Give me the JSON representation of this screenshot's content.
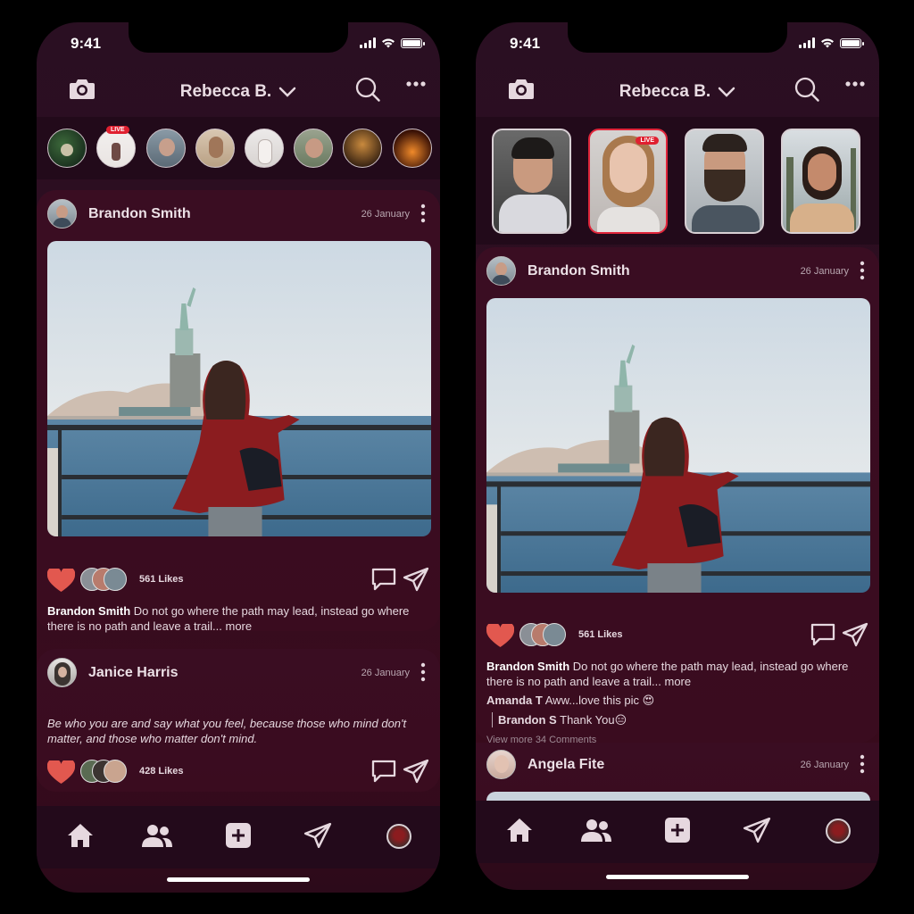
{
  "colors": {
    "accent": "#e2584f",
    "live": "#e0253a",
    "background": "#2e0d20"
  },
  "status": {
    "time": "9:41"
  },
  "header": {
    "account_name": "Rebecca B."
  },
  "stories": {
    "live_label": "LIVE"
  },
  "posts": [
    {
      "author": "Brandon Smith",
      "date": "26 January",
      "likes": "561 Likes",
      "caption_author": "Brandon Smith",
      "caption_text": "Do not go where the path may lead, instead go where there is no path and leave a trail...",
      "more": "more"
    },
    {
      "author": "Janice Harris",
      "date": "26 January",
      "quote": "Be who you are and say what you feel, because those who mind don't matter, and those who matter don't mind.",
      "likes": "428 Likes"
    },
    {
      "author": "Angela Fite",
      "date": "26 January"
    }
  ],
  "comments": [
    {
      "author": "Amanda T",
      "text": "Aww...love this pic",
      "emoji": "😍"
    },
    {
      "author": "Brandon S",
      "text": "Thank You",
      "emoji": "😑"
    }
  ],
  "view_more_comments": "View more 34 Comments",
  "nav": [
    "home-icon",
    "friends-icon",
    "add-post-icon",
    "send-icon",
    "profile-icon"
  ]
}
